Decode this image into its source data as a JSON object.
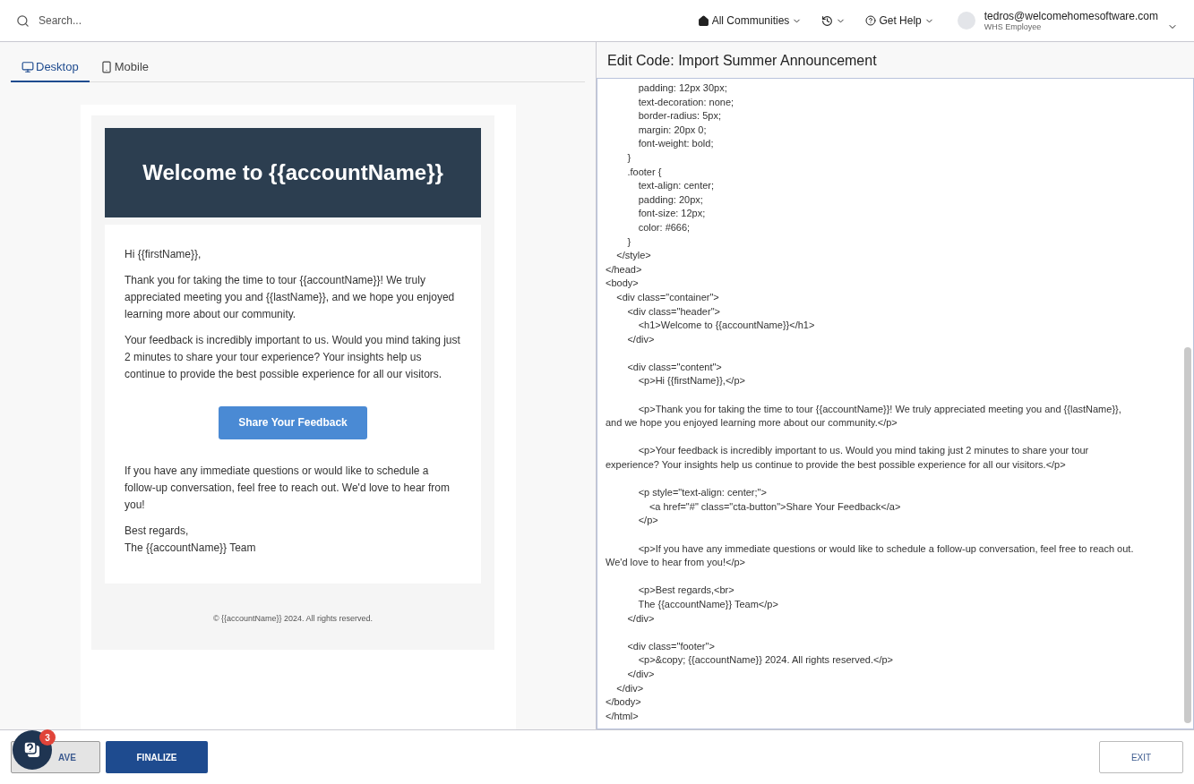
{
  "topbar": {
    "search": {
      "placeholder": "Search..."
    },
    "menus": [
      {
        "kind": "communities",
        "label": "All Communities"
      },
      {
        "kind": "history"
      },
      {
        "kind": "help",
        "label": "Get Help"
      }
    ],
    "user": {
      "email": "tedros@welcomehomesoftware.com",
      "role": "WHS Employee"
    }
  },
  "preview": {
    "tabs": [
      {
        "kind": "desktop",
        "label": "Desktop",
        "selected": true
      },
      {
        "kind": "mobile",
        "label": "Mobile",
        "selected": false
      }
    ],
    "email": {
      "heading": "Welcome to {{accountName}}",
      "greeting": "Hi {{firstName}},",
      "paragraphs": [
        "Thank you for taking the time to tour {{accountName}}! We truly appreciated meeting you and {{lastName}}, and we hope you enjoyed learning more about our community.",
        "Your feedback is incredibly important to us. Would you mind taking just 2 minutes to share your tour experience? Your insights help us continue to provide the best possible experience for all our visitors."
      ],
      "cta": "Share Your Feedback",
      "closing": "If you have any immediate questions or would like to schedule a follow-up conversation, feel free to reach out. We'd love to hear from you!",
      "signoff": [
        "Best regards,",
        "The {{accountName}} Team"
      ],
      "footer": "© {{accountName}} 2024. All rights reserved."
    }
  },
  "editor": {
    "title": "Edit Code: Import Summer Announcement",
    "blocks": [
      [
        "            padding: 12px 30px;",
        "            text-decoration: none;",
        "            border-radius: 5px;",
        "            margin: 20px 0;",
        "            font-weight: bold;",
        "        }",
        "        .footer {",
        "            text-align: center;",
        "            padding: 20px;",
        "            font-size: 12px;",
        "            color: #666;",
        "        }",
        "    </style>",
        "</head>",
        "<body>",
        "    <div class=\"container\">",
        "        <div class=\"header\">",
        "            <h1>Welcome to {{accountName}}</h1>",
        "        </div>"
      ],
      [
        "        <div class=\"content\">",
        "            <p>Hi {{firstName}},</p>"
      ],
      [
        "            <p>Thank you for taking the time to tour {{accountName}}! We truly appreciated meeting you and {{lastName}},",
        "and we hope you enjoyed learning more about our community.</p>"
      ],
      [
        "            <p>Your feedback is incredibly important to us. Would you mind taking just 2 minutes to share your tour",
        "experience? Your insights help us continue to provide the best possible experience for all our visitors.</p>"
      ],
      [
        "            <p style=\"text-align: center;\">",
        "                <a href=\"#\" class=\"cta-button\">Share Your Feedback</a>",
        "            </p>"
      ],
      [
        "            <p>If you have any immediate questions or would like to schedule a follow-up conversation, feel free to reach out.",
        "We'd love to hear from you!</p>"
      ],
      [
        "            <p>Best regards,<br>",
        "            The {{accountName}} Team</p>",
        "        </div>"
      ],
      [
        "        <div class=\"footer\">",
        "            <p>&copy; {{accountName}} 2024. All rights reserved.</p>",
        "        </div>",
        "    </div>",
        "</body>",
        "</html>"
      ]
    ]
  },
  "footer_bar": {
    "buttons": [
      {
        "kind": "save",
        "label": "AVE"
      },
      {
        "kind": "finalize",
        "label": "FINALIZE"
      },
      {
        "kind": "exit",
        "label": "EXIT"
      }
    ],
    "chat": {
      "badge": "3"
    }
  }
}
